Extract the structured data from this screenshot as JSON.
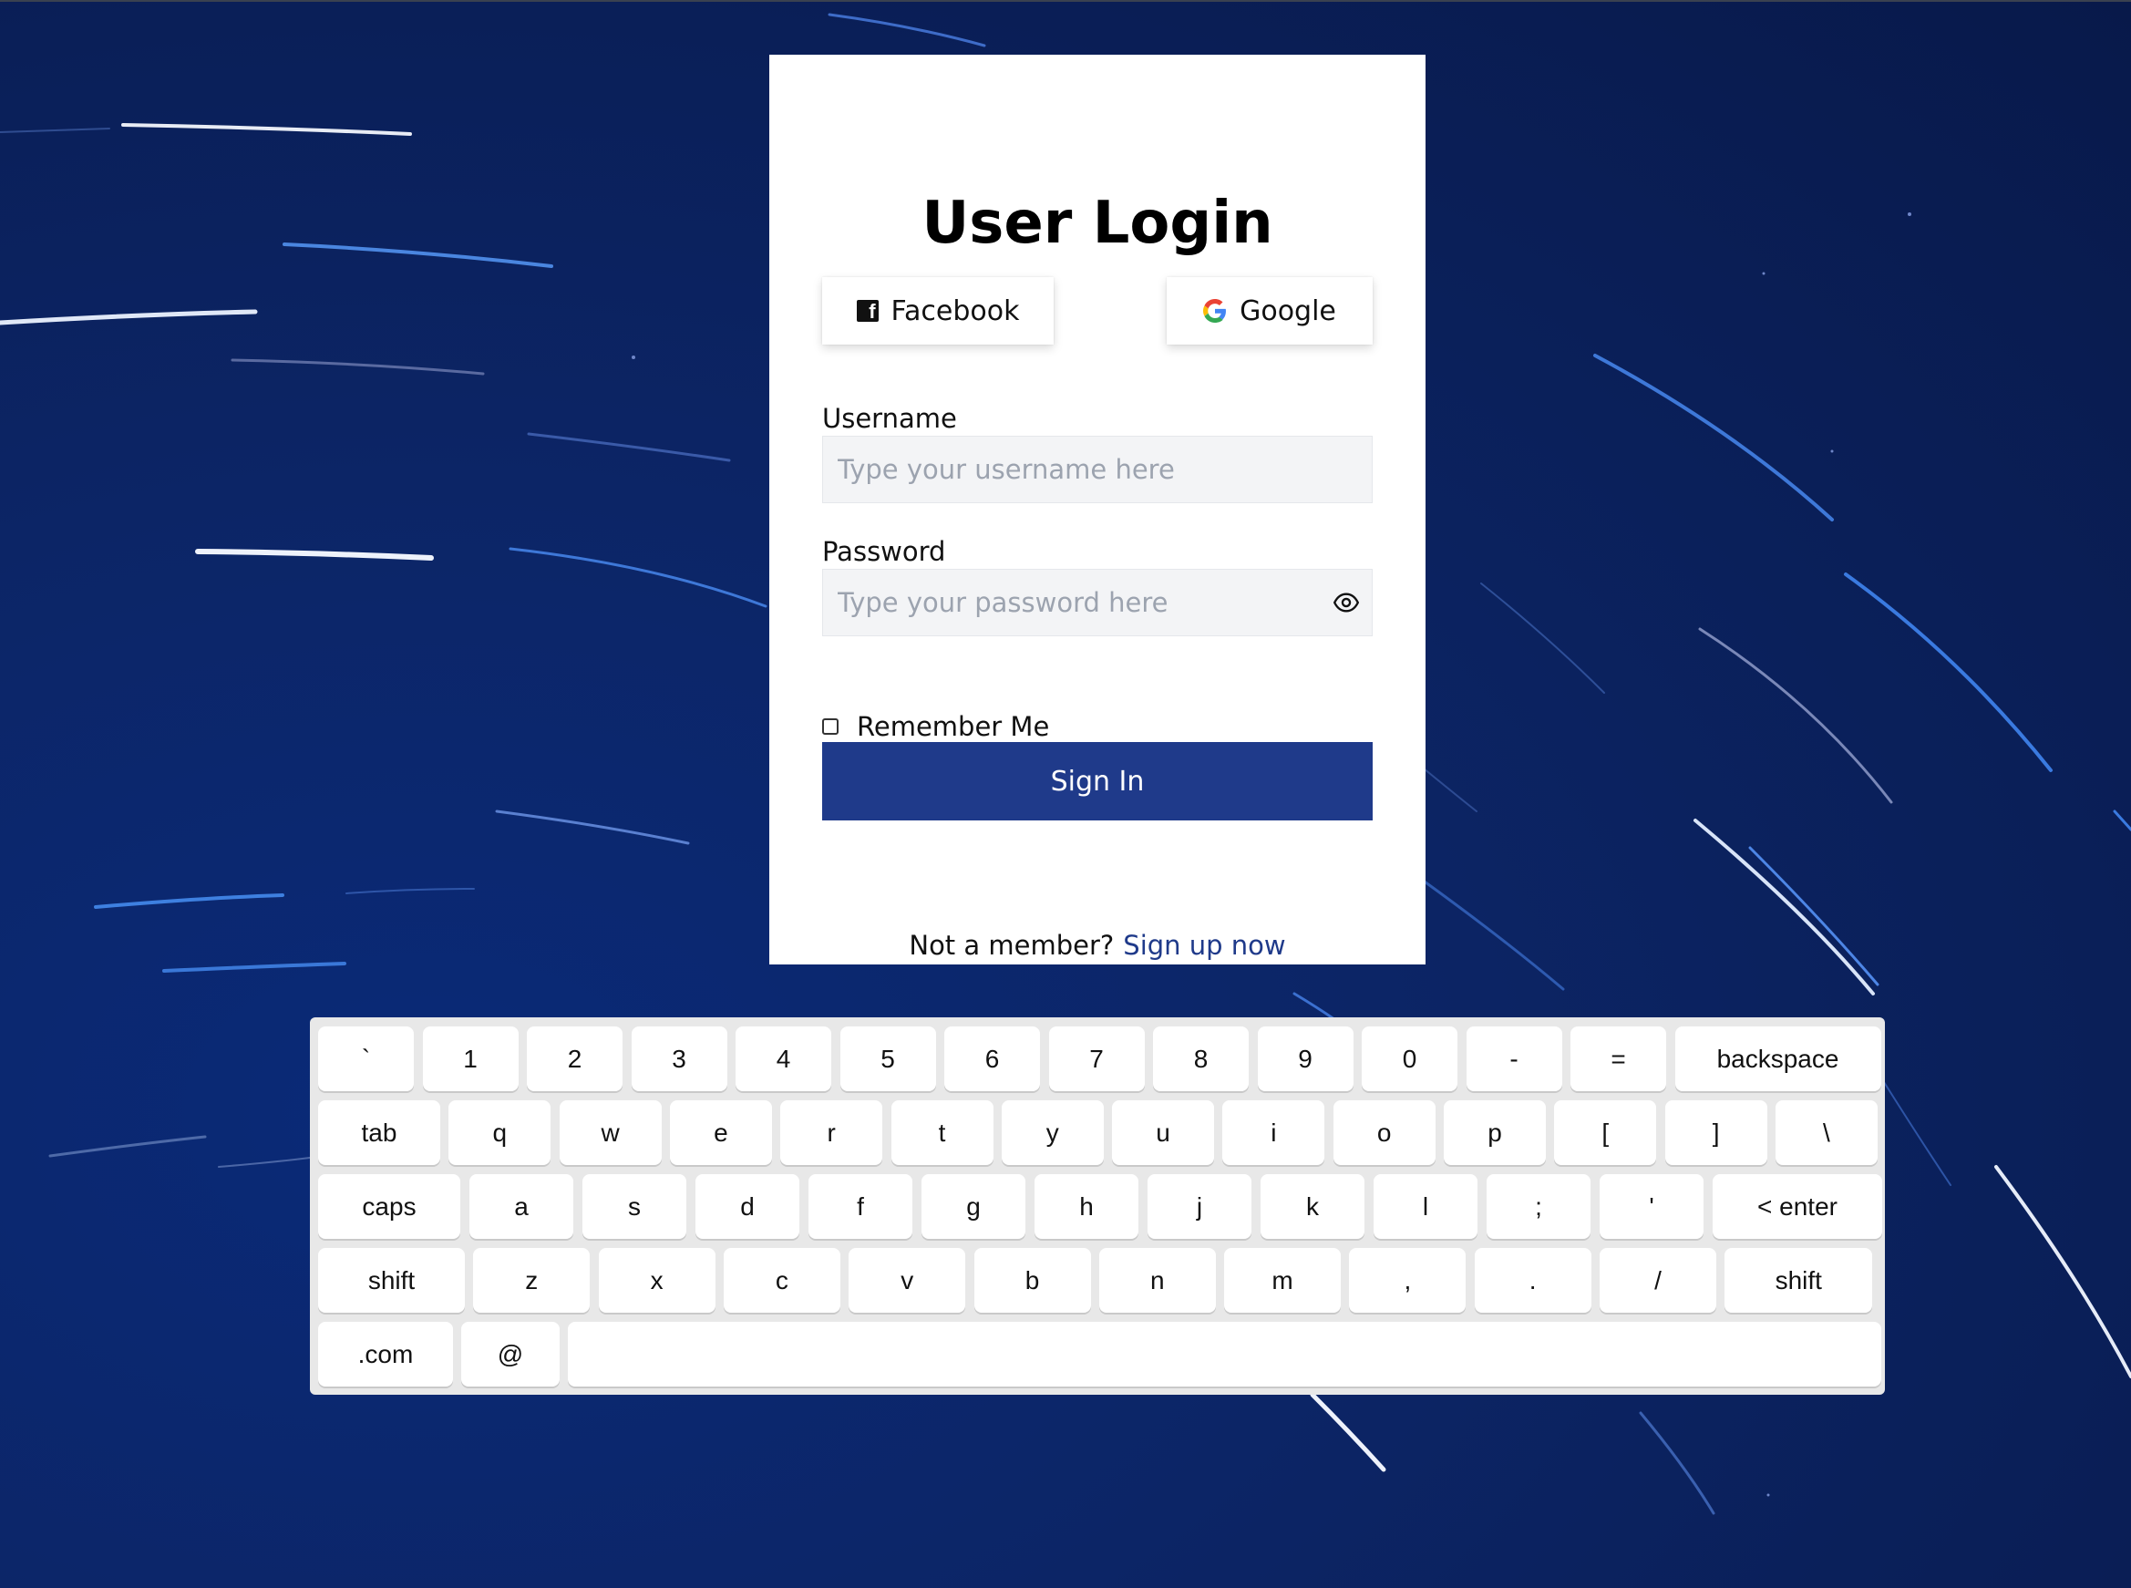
{
  "colors": {
    "background": "#0c2566",
    "card": "#ffffff",
    "primary": "#1f3a8a",
    "field_bg": "#f3f4f6",
    "placeholder": "#9ca3af",
    "keyboard_bg": "#e8e8e8"
  },
  "login": {
    "title": "User Login",
    "social": {
      "facebook_label": "Facebook",
      "facebook_icon": "facebook-icon",
      "google_label": "Google",
      "google_icon": "google-icon"
    },
    "username": {
      "label": "Username",
      "value": "",
      "placeholder": "Type your username here"
    },
    "password": {
      "label": "Password",
      "value": "",
      "placeholder": "Type your password here",
      "toggle_icon": "eye-icon"
    },
    "remember": {
      "label": "Remember Me",
      "checked": false
    },
    "signin_label": "Sign In",
    "footer": {
      "prompt": "Not a member?",
      "link": "Sign up now"
    }
  },
  "keyboard": {
    "rows": [
      [
        "`",
        "1",
        "2",
        "3",
        "4",
        "5",
        "6",
        "7",
        "8",
        "9",
        "0",
        "-",
        "=",
        "backspace"
      ],
      [
        "tab",
        "q",
        "w",
        "e",
        "r",
        "t",
        "y",
        "u",
        "i",
        "o",
        "p",
        "[",
        "]",
        "\\"
      ],
      [
        "caps",
        "a",
        "s",
        "d",
        "f",
        "g",
        "h",
        "j",
        "k",
        "l",
        ";",
        "'",
        "< enter"
      ],
      [
        "shift",
        "z",
        "x",
        "c",
        "v",
        "b",
        "n",
        "m",
        ",",
        ".",
        "/",
        "shift"
      ],
      [
        ".com",
        "@",
        ""
      ]
    ]
  }
}
